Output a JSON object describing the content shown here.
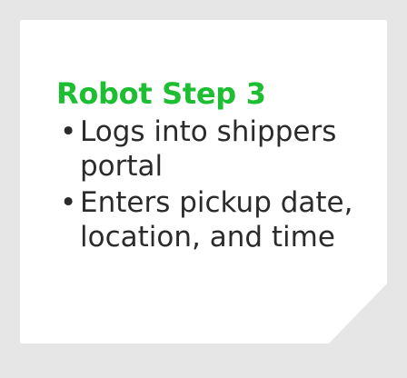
{
  "card": {
    "title": "Robot Step 3",
    "bullets": [
      "Logs into shippers portal",
      "Enters pickup date, location, and time"
    ],
    "bullet_symbol": "•",
    "colors": {
      "frame": "#e6e6e6",
      "panel": "#ffffff",
      "title": "#1dbe31",
      "text": "#2b2b2b"
    }
  }
}
